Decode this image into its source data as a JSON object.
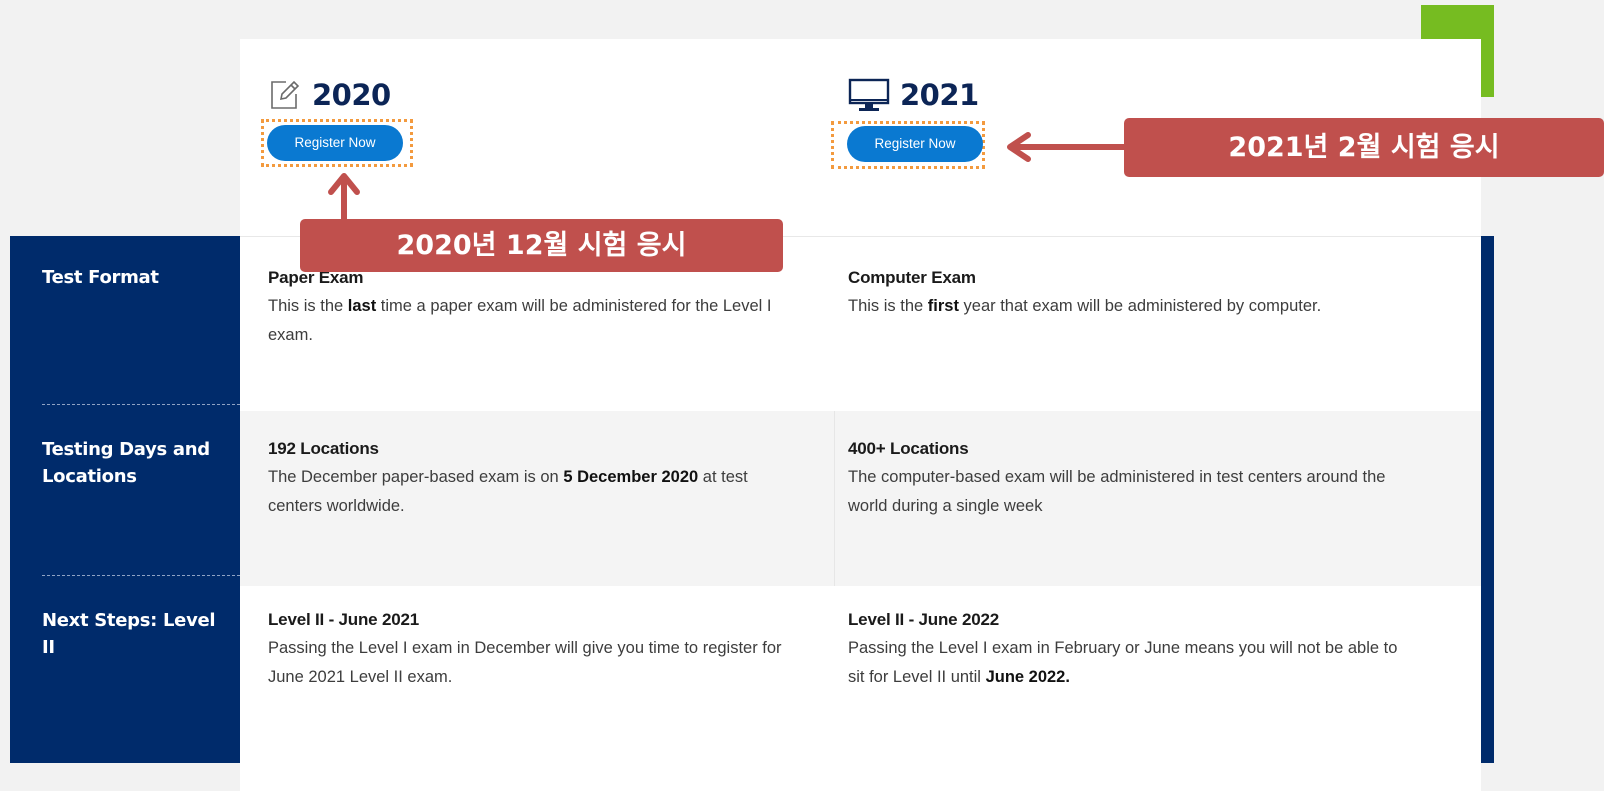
{
  "columns": [
    {
      "year": "2020",
      "icon": "edit-pencil-icon",
      "register_label": "Register Now",
      "callout": "2020년 12월 시험 응시"
    },
    {
      "year": "2021",
      "icon": "computer-monitor-icon",
      "register_label": "Register Now",
      "callout": "2021년 2월 시험 응시"
    }
  ],
  "rows": [
    {
      "label": "Test Format",
      "cells": [
        {
          "title": "Paper Exam",
          "pre": "This is the ",
          "strong": "last",
          "post": " time a paper exam will be administered for the Level I exam."
        },
        {
          "title": "Computer Exam",
          "pre": "This is the ",
          "strong": "first",
          "post": " year that exam will be administered by computer."
        }
      ]
    },
    {
      "label": "Testing Days and Locations",
      "cells": [
        {
          "title": "192 Locations",
          "pre": "The December paper-based exam is on ",
          "strong": "5 December 2020",
          "post": " at test centers worldwide."
        },
        {
          "title": "400+ Locations",
          "pre": "The computer-based exam will be administered in test centers around the world during a single week",
          "strong": "",
          "post": ""
        }
      ]
    },
    {
      "label": "Next Steps: Level II",
      "cells": [
        {
          "title": "Level II - June 2021",
          "pre": "Passing the Level I exam in December will give you time to register for June 2021 Level II exam.",
          "strong": "",
          "post": ""
        },
        {
          "title": "Level II - June 2022",
          "pre": "Passing the Level I exam in February or June means you will not be able to sit for Level II until ",
          "strong": "June 2022.",
          "post": ""
        }
      ]
    }
  ],
  "colors": {
    "navy": "#002b6b",
    "button_blue": "#0a79d1",
    "callout_red": "#c0504d",
    "dotted_orange": "#f39a3e",
    "accent_green": "#76bc21"
  }
}
